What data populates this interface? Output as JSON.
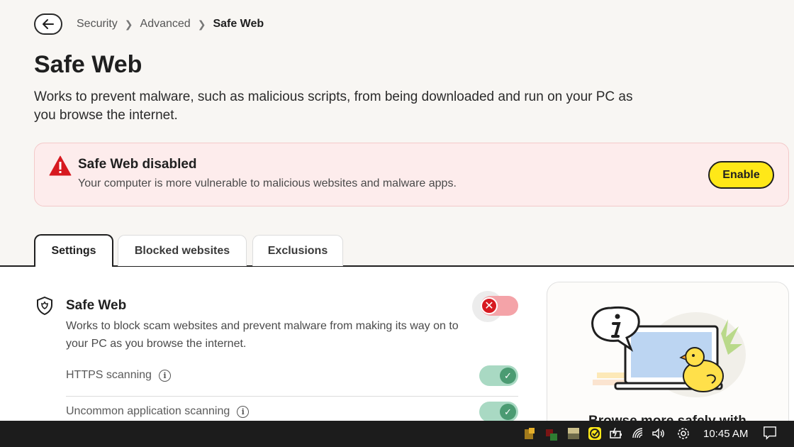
{
  "breadcrumb": [
    "Security",
    "Advanced",
    "Safe Web"
  ],
  "page": {
    "title": "Safe Web",
    "description": "Works to prevent malware, such as malicious scripts, from being downloaded and run on your PC as you browse the internet."
  },
  "alert": {
    "title": "Safe Web disabled",
    "text": "Your computer is more vulnerable to malicious websites and malware apps.",
    "button": "Enable"
  },
  "tabs": [
    "Settings",
    "Blocked websites",
    "Exclusions"
  ],
  "settings": {
    "main_title": "Safe Web",
    "main_desc": "Works to block scam websites and prevent malware from making its way on to your PC as you browse the internet.",
    "main_enabled": false,
    "options": [
      {
        "label": "HTTPS scanning",
        "enabled": true
      },
      {
        "label": "Uncommon application scanning",
        "enabled": true
      }
    ]
  },
  "side_card": {
    "title": "Browse more safely with"
  },
  "taskbar": {
    "time": "10:45 AM"
  },
  "colors": {
    "accent": "#ffe818",
    "danger": "#d71920",
    "success": "#4b9b72"
  }
}
